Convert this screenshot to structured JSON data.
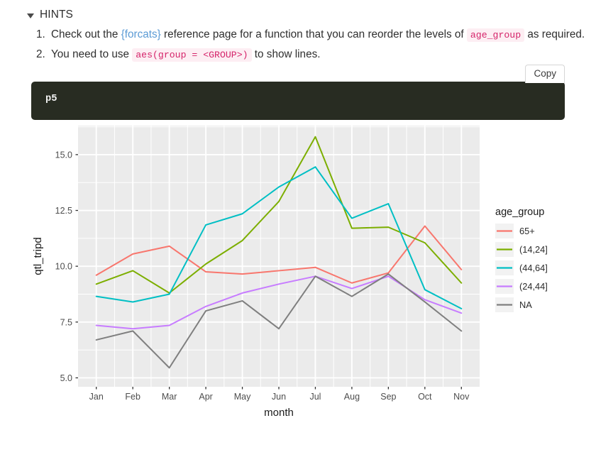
{
  "hints": {
    "toggle_icon": "triangle-down-icon",
    "heading": "HINTS",
    "items": [
      {
        "pre": "Check out the ",
        "link": "{forcats}",
        "mid": " reference page for a function that you can reorder the levels of ",
        "code": "age_group",
        "post": " as required."
      },
      {
        "pre": "You need to use ",
        "code": "aes(group = <GROUP>)",
        "post": " to show lines."
      }
    ]
  },
  "code_chunk": {
    "copy_label": "Copy",
    "content": "p5"
  },
  "chart_data": {
    "type": "line",
    "title": "",
    "xlabel": "month",
    "ylabel": "qtl_tripd",
    "legend_title": "age_group",
    "legend_position": "right",
    "grid": true,
    "panel_bg": "#EBEBEB",
    "grid_color": "#FFFFFF",
    "categories": [
      "Jan",
      "Feb",
      "Mar",
      "Apr",
      "May",
      "Jun",
      "Jul",
      "Aug",
      "Sep",
      "Oct",
      "Nov"
    ],
    "ylim": [
      4.6,
      16.3
    ],
    "yticks": [
      5.0,
      7.5,
      10.0,
      12.5,
      15.0
    ],
    "ytick_labels": [
      "5.0",
      "7.5",
      "10.0",
      "12.5",
      "15.0"
    ],
    "series": [
      {
        "name": "65+",
        "color": "#F8766D",
        "values": [
          9.6,
          10.55,
          10.9,
          9.75,
          9.65,
          9.8,
          9.95,
          9.25,
          9.7,
          11.8,
          9.85
        ]
      },
      {
        "name": "(14,24]",
        "color": "#7CAE00",
        "values": [
          9.2,
          9.8,
          8.8,
          10.1,
          11.15,
          12.9,
          15.8,
          11.7,
          11.75,
          11.05,
          9.25
        ]
      },
      {
        "name": "(44,64]",
        "color": "#00BFC4",
        "values": [
          8.65,
          8.4,
          8.75,
          11.85,
          12.35,
          13.55,
          14.45,
          12.15,
          12.8,
          8.95,
          8.1
        ]
      },
      {
        "name": "(24,44]",
        "color": "#C77CFF",
        "values": [
          7.35,
          7.2,
          7.35,
          8.2,
          8.8,
          9.2,
          9.55,
          9.0,
          9.55,
          8.5,
          7.9
        ]
      },
      {
        "name": "NA",
        "color": "#7F7F7F",
        "values": [
          6.7,
          7.1,
          5.45,
          8.0,
          8.45,
          7.2,
          9.55,
          8.65,
          9.65,
          8.4,
          7.1
        ]
      }
    ]
  }
}
